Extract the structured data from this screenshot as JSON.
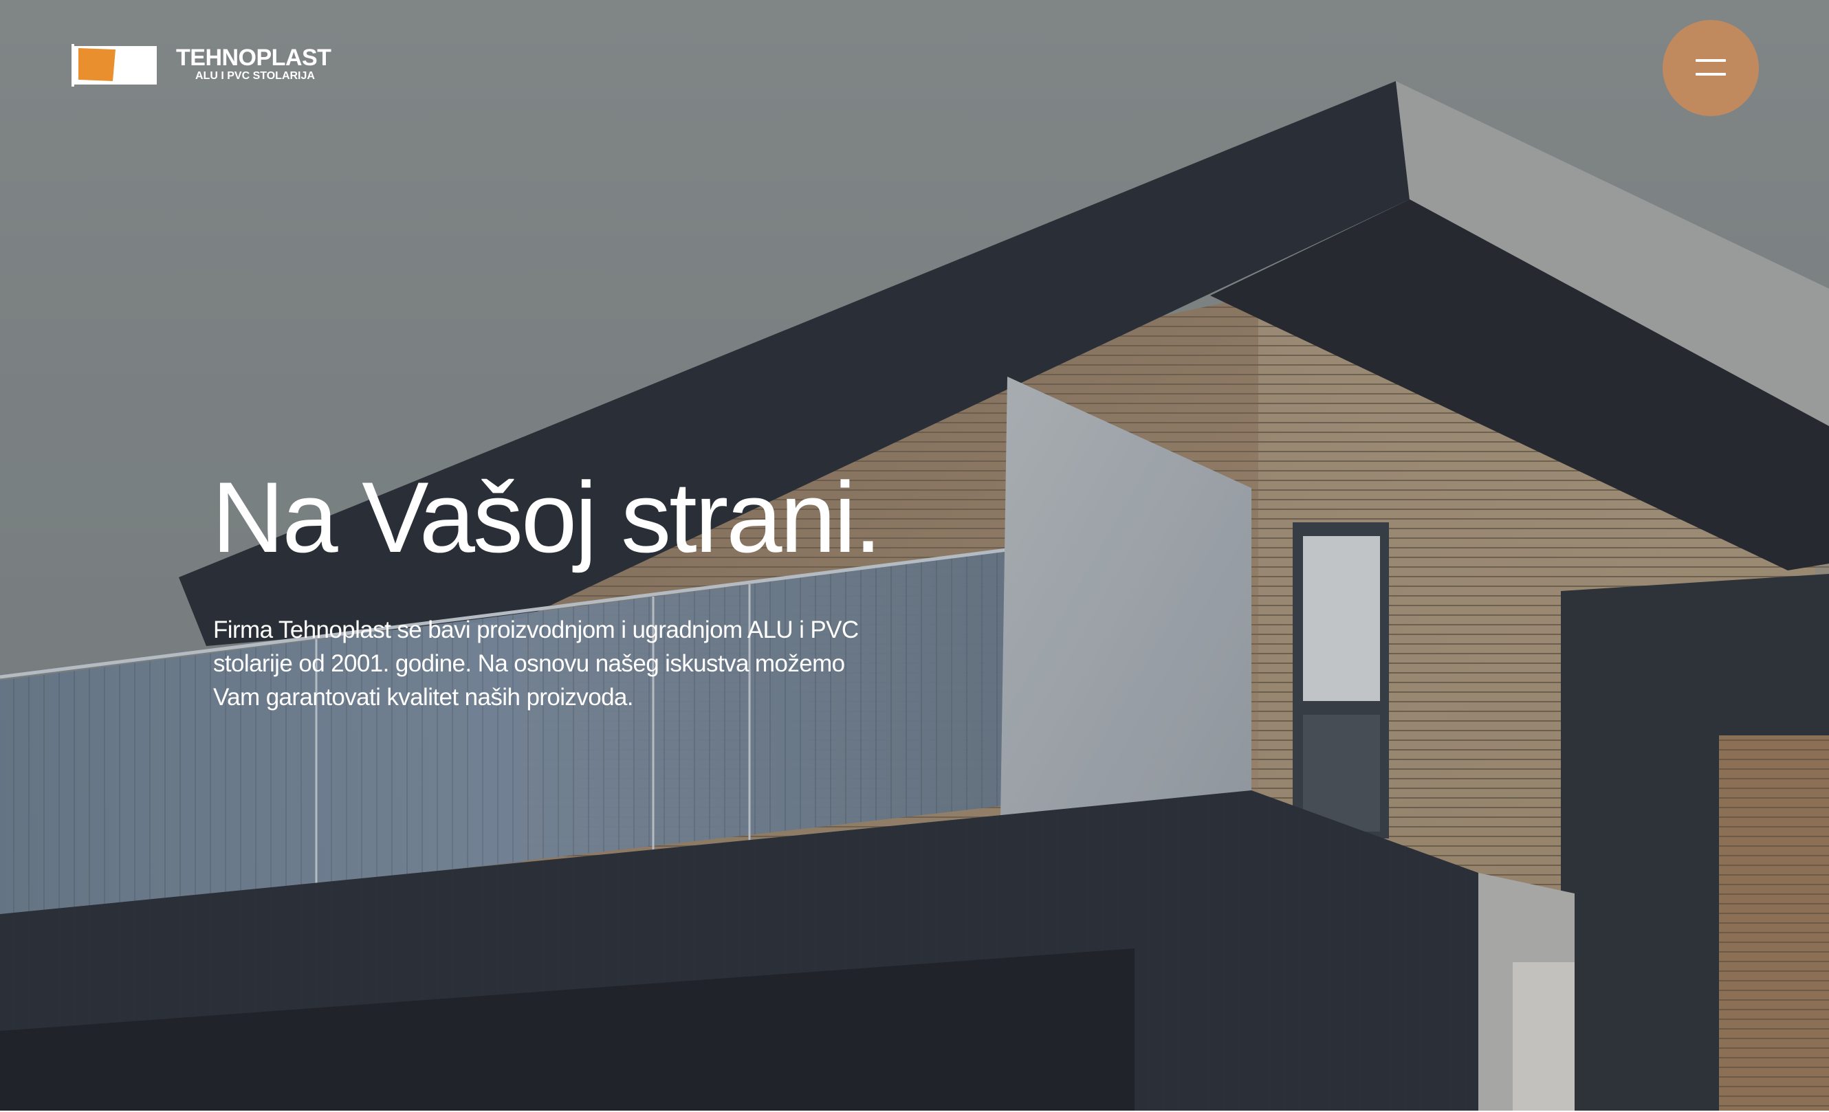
{
  "brand": {
    "name": "TEHNOPLAST",
    "tagline": "ALU I PVC STOLARIJA",
    "accent_color": "#e98f2d"
  },
  "menu": {
    "icon": "hamburger-menu-icon",
    "button_color": "#c1895e"
  },
  "hero": {
    "headline": "Na Vašoj strani.",
    "text": "Firma Tehnoplast se bavi proizvodnjom i ugradnjom ALU i PVC stolarije od 2001. godine. Na osnovu našeg iskustva možemo Vam garantovati kvalitet naših proizvoda."
  }
}
